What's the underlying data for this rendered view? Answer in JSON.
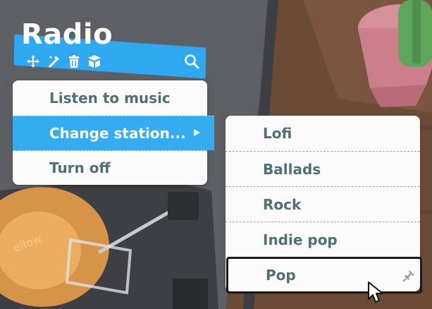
{
  "title": "Radio",
  "toolbar": {
    "icons": [
      "move-icon",
      "wand-icon",
      "trash-icon",
      "box-icon"
    ],
    "search_icon": "search-icon"
  },
  "menu": {
    "items": [
      {
        "label": "Listen to music"
      },
      {
        "label": "Change station..."
      },
      {
        "label": "Turn off"
      }
    ],
    "active_index": 1
  },
  "submenu": {
    "items": [
      {
        "label": "Lofi"
      },
      {
        "label": "Ballads"
      },
      {
        "label": "Rock"
      },
      {
        "label": "Indie pop"
      },
      {
        "label": "Pop"
      }
    ],
    "hover_index": 4
  },
  "colors": {
    "accent": "#35acf2",
    "menu_text": "#4f7076",
    "menu_bg": "#fbfbfb"
  }
}
